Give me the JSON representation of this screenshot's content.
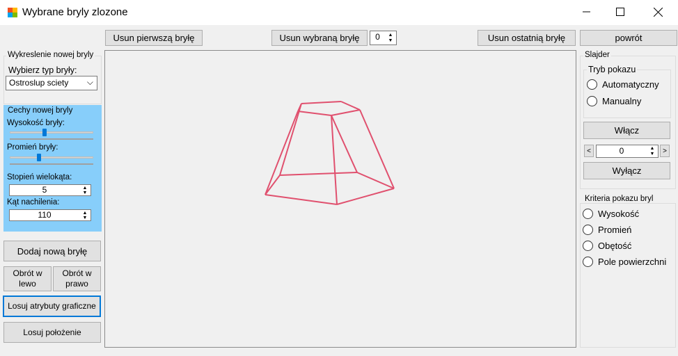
{
  "window": {
    "title": "Wybrane bryly zlozone",
    "minimize_glyph": "—",
    "maximize_glyph": "☐",
    "close_glyph": "✕"
  },
  "toolbar": {
    "remove_first": "Usun pierwszą bryłę",
    "remove_selected": "Usun wybraną bryłę",
    "selected_index": "0",
    "remove_last": "Usun ostatnią bryłę",
    "back": "powrót"
  },
  "left": {
    "group_title": "Wykreslenie nowej bryly",
    "type_label": "Wybierz typ bryły:",
    "type_value": "Ostroslup sciety",
    "features_title": "Cechy nowej bryly",
    "height_label": "Wysokość bryły:",
    "height_level": 0.42,
    "radius_label": "Promień bryły:",
    "radius_level": 0.35,
    "degree_label": "Stopień wielokąta:",
    "degree_value": "5",
    "angle_label": "Kąt nachilenia:",
    "angle_value": "110",
    "add_button": "Dodaj nową bryłę",
    "rotate_left": "Obrót w lewo",
    "rotate_right": "Obrót w prawo",
    "random_attrs": "Losuj atrybuty graficzne",
    "random_position": "Losuj położenie"
  },
  "slider": {
    "group_title": "Slajder",
    "mode_title": "Tryb pokazu",
    "mode_auto": "Automatyczny",
    "mode_manual": "Manualny",
    "on_button": "Włącz",
    "prev_glyph": "<",
    "next_glyph": ">",
    "index_value": "0",
    "off_button": "Wyłącz"
  },
  "criteria": {
    "group_title": "Kriteria pokazu bryl",
    "options": [
      "Wysokość",
      "Promień",
      "Obętość",
      "Pole powierzchni"
    ]
  },
  "canvas": {
    "stroke_color": "#e0506e"
  },
  "icons": {
    "spin_up": "▲",
    "spin_down": "▼",
    "dropdown": "⌵"
  }
}
